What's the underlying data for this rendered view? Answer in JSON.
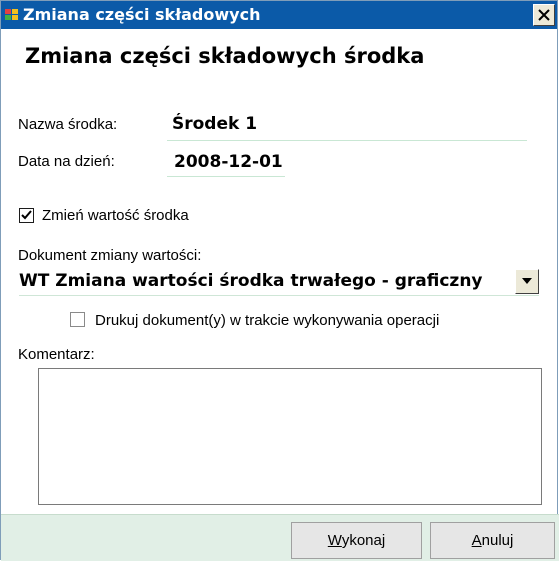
{
  "window": {
    "title": "Zmiana części składowych",
    "close_icon": "close-icon",
    "app_icon": "app-icon"
  },
  "form": {
    "heading": "Zmiana części składowych środka",
    "asset_name_label": "Nazwa środka:",
    "asset_name_value": "Środek 1",
    "date_label": "Data na dzień:",
    "date_value": "2008-12-01",
    "change_value_checkbox": {
      "label": "Zmień wartość środka",
      "checked": true
    },
    "document_label": "Dokument zmiany wartości:",
    "document_selected": "WT Zmiana wartości środka trwałego - graficzny",
    "print_checkbox": {
      "label": "Drukuj dokument(y) w trakcie wykonywania operacji",
      "checked": false
    },
    "comment_label": "Komentarz:",
    "comment_value": ""
  },
  "buttons": {
    "execute_label": "Wykonaj",
    "execute_mnemonic": "W",
    "execute_rest": "ykonaj",
    "cancel_label": "Anuluj",
    "cancel_mnemonic": "A",
    "cancel_rest": "nuluj"
  },
  "colors": {
    "titlebar": "#0b5aa8",
    "footer": "#e1efe6"
  }
}
